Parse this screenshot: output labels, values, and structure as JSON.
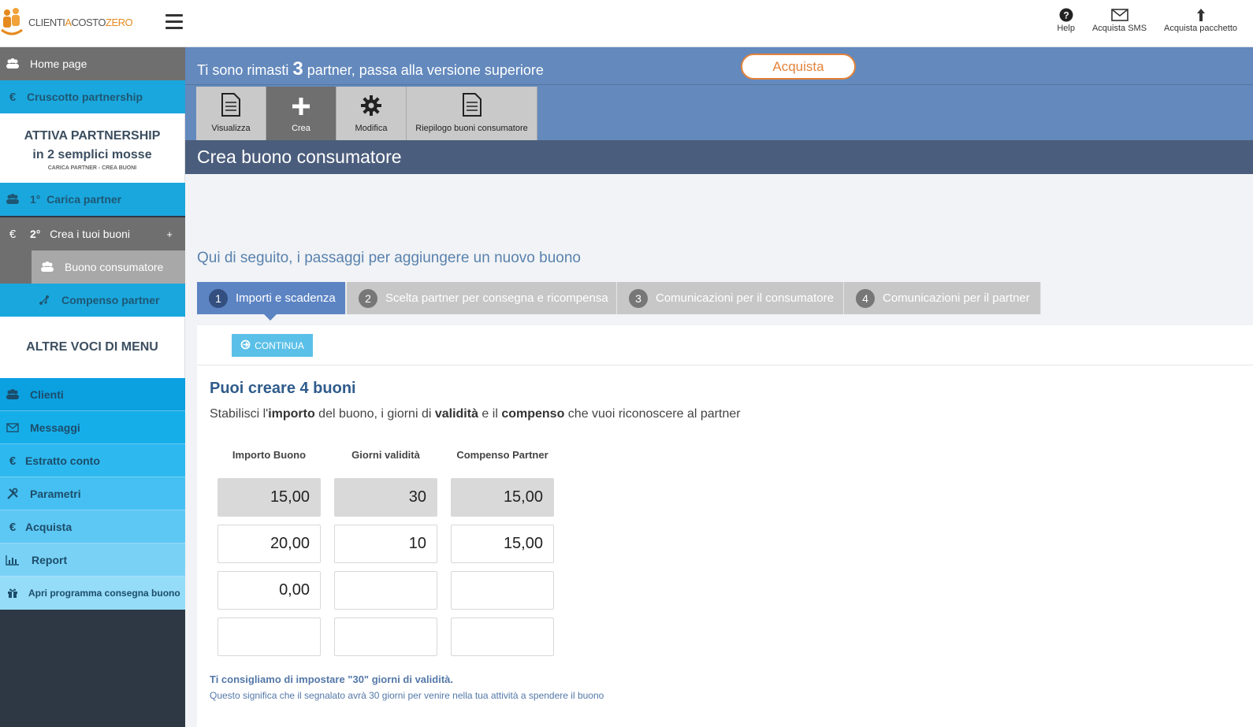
{
  "header": {
    "logo": {
      "part1": "CLIENTI",
      "part2": "A",
      "part3": "COSTO",
      "part4": "ZERO"
    },
    "actions": [
      {
        "label": "Help",
        "icon": "help-icon"
      },
      {
        "label": "Acquista SMS",
        "icon": "envelope-icon"
      },
      {
        "label": "Acquista pacchetto",
        "icon": "upload-arrow-icon"
      }
    ]
  },
  "sidebar": {
    "home": "Home page",
    "cruscotto": "Cruscotto partnership",
    "partnership_box": {
      "line1": "ATTIVA PARTNERSHIP",
      "line2": "in 2 semplici mosse",
      "line3": "CARICA PARTNER - CREA BUONI"
    },
    "carica": {
      "num": "1°",
      "label": "Carica partner"
    },
    "crea": {
      "num": "2°",
      "label": "Crea i tuoi buoni",
      "toggle": "+"
    },
    "buono": "Buono consumatore",
    "compenso": "Compenso partner",
    "altre_voci": "ALTRE VOCI DI MENU",
    "items": [
      {
        "label": "Clienti",
        "icon": "users-icon"
      },
      {
        "label": "Messaggi",
        "icon": "envelope-icon"
      },
      {
        "label": "Estratto conto",
        "icon": "euro-icon"
      },
      {
        "label": "Parametri",
        "icon": "tools-icon"
      },
      {
        "label": "Acquista",
        "icon": "euro-icon"
      },
      {
        "label": "Report",
        "icon": "bar-chart-icon"
      },
      {
        "label": "Apri programma consegna buono",
        "icon": "gift-icon"
      }
    ]
  },
  "banner": {
    "text_before": "Ti sono rimasti ",
    "count": "3",
    "text_after": " partner, passa alla versione superiore",
    "button": "Acquista"
  },
  "toolbar": [
    {
      "label": "Visualizza",
      "icon": "document-icon",
      "active": false
    },
    {
      "label": "Crea",
      "icon": "plus-icon",
      "active": true
    },
    {
      "label": "Modifica",
      "icon": "gear-icon",
      "active": false
    },
    {
      "label": "Riepilogo buoni consumatore",
      "icon": "document-icon",
      "active": false
    }
  ],
  "page_title": "Crea buono consumatore",
  "steps_intro": "Qui di seguito, i passaggi per aggiungere un nuovo buono",
  "steps": [
    {
      "num": "1",
      "label": "Importi e scadenza",
      "active": true
    },
    {
      "num": "2",
      "label": "Scelta partner per consegna e ricompensa",
      "active": false
    },
    {
      "num": "3",
      "label": "Comunicazioni per il consumatore",
      "active": false
    },
    {
      "num": "4",
      "label": "Comunicazioni per il partner",
      "active": false
    }
  ],
  "form": {
    "continue_button": "CONTINUA",
    "title": "Puoi creare 4 buoni",
    "subtitle": {
      "p1": "Stabilisci l'",
      "b1": "importo",
      "p2": " del buono, i giorni di ",
      "b2": "validità",
      "p3": " e il ",
      "b3": "compenso",
      "p4": " che vuoi riconoscere al partner"
    },
    "columns": [
      "Importo Buono",
      "Giorni validità",
      "Compenso Partner"
    ],
    "rows": [
      {
        "importo": "15,00",
        "giorni": "30",
        "compenso": "15,00",
        "readonly": true
      },
      {
        "importo": "20,00",
        "giorni": "10",
        "compenso": "15,00",
        "readonly": false
      },
      {
        "importo": "0,00",
        "giorni": "",
        "compenso": "",
        "readonly": false
      },
      {
        "importo": "",
        "giorni": "",
        "compenso": "",
        "readonly": false
      }
    ],
    "note_bold": "Ti consigliamo di impostare \"30\" giorni di validità.",
    "note": "Questo significa che il segnalato avrà 30 giorni per venire nella tua attività a spendere il buono"
  },
  "colors": {
    "banner": "#6389bd",
    "accent_orange": "#e3833b",
    "sidebar_blue": "#1aa7dd",
    "step_active": "#5c84c3",
    "page_bar": "#4b5d7c"
  }
}
